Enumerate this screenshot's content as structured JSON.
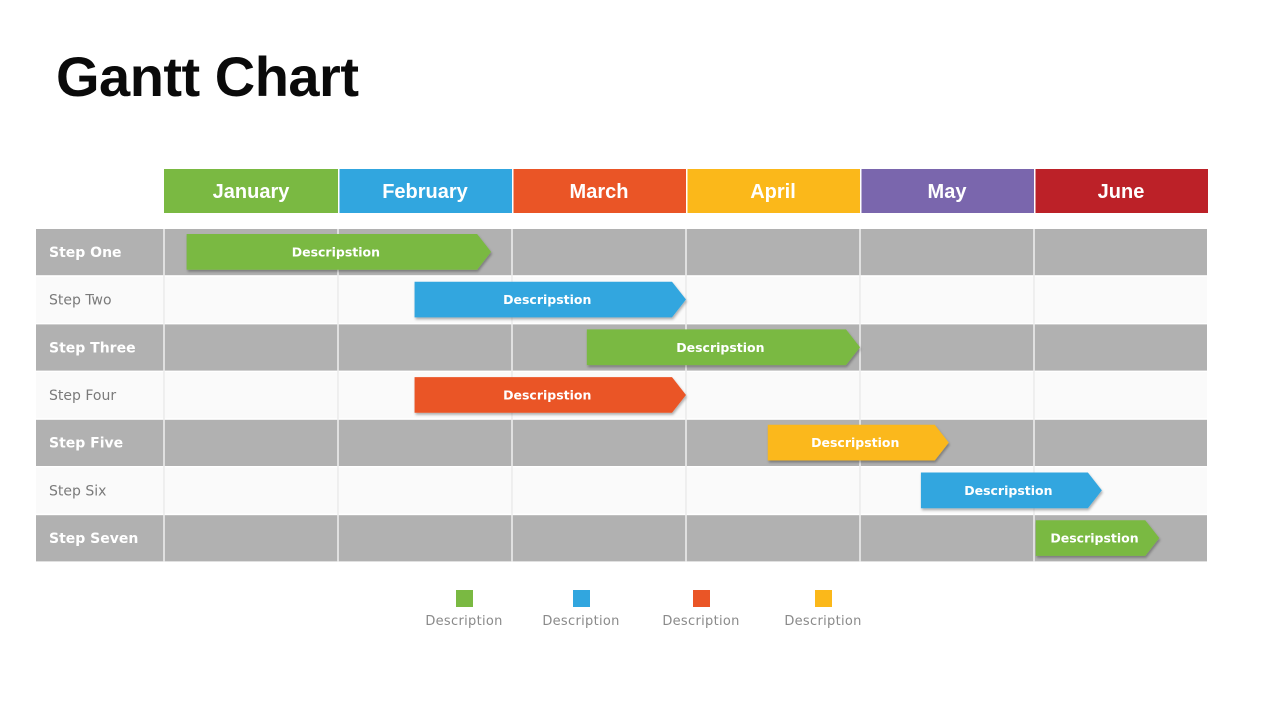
{
  "title": "Gantt Chart",
  "chart_data": {
    "type": "gantt",
    "title": "Gantt Chart",
    "time_axis": {
      "unit": "month",
      "categories": [
        "January",
        "February",
        "March",
        "April",
        "May",
        "June"
      ],
      "category_colors": [
        "#7ab942",
        "#31a6df",
        "#ea5526",
        "#fbb81a",
        "#7a66ad",
        "#bc2128"
      ]
    },
    "tasks": [
      {
        "name": "Step One",
        "label": "Descripstion",
        "start": 0.13,
        "end": 1.88,
        "color": "#7ab942"
      },
      {
        "name": "Step Two",
        "label": "Descripstion",
        "start": 1.44,
        "end": 3.0,
        "color": "#31a6df"
      },
      {
        "name": "Step Three",
        "label": "Descripstion",
        "start": 2.43,
        "end": 4.0,
        "color": "#7ab942"
      },
      {
        "name": "Step Four",
        "label": "Descripstion",
        "start": 1.44,
        "end": 3.0,
        "color": "#ea5526"
      },
      {
        "name": "Step Five",
        "label": "Descripstion",
        "start": 3.47,
        "end": 4.51,
        "color": "#fbb81a"
      },
      {
        "name": "Step Six",
        "label": "Descripstion",
        "start": 4.35,
        "end": 5.39,
        "color": "#31a6df"
      },
      {
        "name": "Step Seven",
        "label": "Descripstion",
        "start": 5.01,
        "end": 5.72,
        "color": "#7ab942"
      }
    ],
    "row_colors": {
      "odd": "#b1b1b1",
      "even": "#fafafa"
    },
    "row_label_colors": {
      "odd": "#ffffff",
      "even": "#7a7a7a"
    },
    "grid": true,
    "legend": {
      "placement": "bottom",
      "entries": [
        {
          "label": "Description",
          "color": "#7ab942"
        },
        {
          "label": "Description",
          "color": "#31a6df"
        },
        {
          "label": "Description",
          "color": "#ea5526"
        },
        {
          "label": "Description",
          "color": "#fbb81a"
        }
      ]
    }
  }
}
